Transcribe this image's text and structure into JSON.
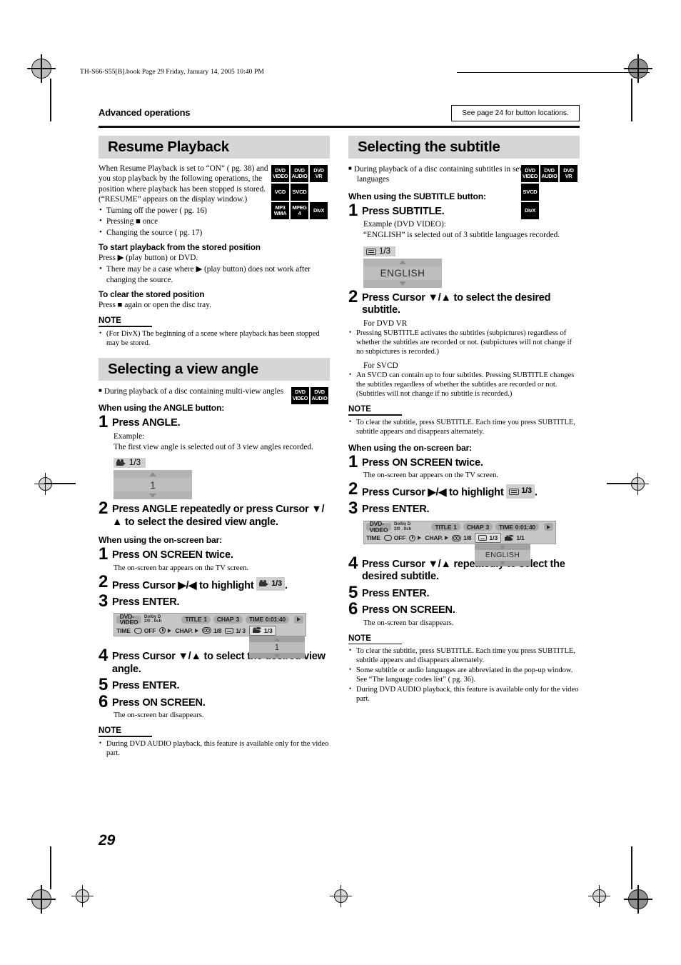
{
  "page": {
    "book_line": "TH-S66-S55[B].book  Page 29  Friday, January 14, 2005  10:40 PM",
    "section_label": "Advanced operations",
    "see_page_note": "See page 24 for button locations.",
    "page_number": "29"
  },
  "left_column": {
    "resume": {
      "title": "Resume Playback",
      "intro": "When Resume Playback is set to “ON” ( pg. 38) and you stop playback by the following operations, the position where playback has been stopped is stored. (“RESUME” appears on the display window.)",
      "bullets": [
        "Turning off the power ( pg. 16)",
        "Pressing ■ once",
        "Changing the source ( pg. 17)"
      ],
      "discs": [
        "DVD VIDEO",
        "DVD AUDIO",
        "DVD VR",
        "VCD",
        "SVCD",
        "MP3 WMA",
        "MPEG 4",
        "DivX"
      ],
      "start_head": "To start playback from the stored position",
      "start_body": "Press ▶ (play button) or DVD.",
      "start_bullets": [
        "There may be a case where ▶ (play button) does not work after changing the source."
      ],
      "clear_head": "To clear the stored position",
      "clear_body": "Press ■ again or open the disc tray.",
      "note_head": "NOTE",
      "note_bullets": [
        "(For DivX) The beginning of a scene where playback has been stopped may be stored."
      ]
    },
    "angle": {
      "title": "Selecting a view angle",
      "lead": "During playback of a disc containing multi-view angles",
      "discs": [
        "DVD VIDEO",
        "DVD AUDIO"
      ],
      "button_head": "When using the ANGLE button:",
      "steps_button": [
        {
          "num": "1",
          "text": "Press ANGLE."
        },
        {
          "num": "2",
          "text": "Press ANGLE repeatedly or press Cursor ▼/▲ to select the desired view angle."
        }
      ],
      "example_label": "Example:",
      "example_text": "The first view angle is selected out of 3 view angles recorded.",
      "popup": {
        "tag": "1/3",
        "value": "1"
      },
      "onscreen_head": "When using the on-screen bar:",
      "steps_onscreen": [
        {
          "num": "1",
          "text": "Press ON SCREEN twice.",
          "sub": "The on-screen bar appears on the TV screen."
        },
        {
          "num": "2",
          "text": "Press Cursor ▶/◀ to highlight",
          "chip": "1/3",
          "tail": "."
        },
        {
          "num": "3",
          "text": "Press ENTER."
        },
        {
          "num": "4",
          "text": "Press Cursor ▼/▲ to select the desired view angle."
        },
        {
          "num": "5",
          "text": "Press ENTER."
        },
        {
          "num": "6",
          "text": "Press ON SCREEN.",
          "sub": "The on-screen bar disappears."
        }
      ],
      "note_head": "NOTE",
      "note_bullets": [
        "During DVD AUDIO playback, this feature is available only for the video part."
      ]
    },
    "osbar": {
      "disc_type": "DVD-VIDEO",
      "dolby_line1": "Dolby D",
      "dolby_line2": "2/0 . 0ch",
      "title_label": "TITLE",
      "title_value": "1",
      "chap_label": "CHAP",
      "chap_value": "3",
      "time_label": "TIME",
      "time_value": "0:01:40",
      "row2_time": "TIME",
      "row2_repeat": "OFF",
      "row2_chapter": "CHAP.",
      "row2_audio": "1/8",
      "row2_subtitle": "1/ 3",
      "row2_angle": "1/3",
      "dropdown_value": "1"
    }
  },
  "right_column": {
    "subtitle": {
      "title": "Selecting the subtitle",
      "lead": "During playback of a disc containing subtitles in several languages",
      "discs": [
        "DVD VIDEO",
        "DVD AUDIO",
        "DVD VR",
        "SVCD",
        "DivX"
      ],
      "button_head": "When using the SUBTITLE button:",
      "steps_button": [
        {
          "num": "1",
          "text": "Press SUBTITLE."
        },
        {
          "num": "2",
          "text": "Press Cursor ▼/▲ to select the desired subtitle."
        }
      ],
      "example_label": "Example (DVD VIDEO):",
      "example_text": "“ENGLISH” is selected out of 3 subtitle languages recorded.",
      "popup": {
        "tag": "1/3",
        "value": "ENGLISH"
      },
      "dvdvr_head": "For DVD VR",
      "dvdvr_bullets": [
        "Pressing SUBTITLE activates the subtitles (subpictures) regardless of whether the subtitles are recorded or not. (subpictures will not change if no subpictures is recorded.)"
      ],
      "svcd_head": "For SVCD",
      "svcd_bullets": [
        "An SVCD can contain up to four subtitles. Pressing SUBTITLE changes the subtitles regardless of whether the subtitles are recorded or not. (Subtitles will not change if no subtitle is recorded.)"
      ],
      "note1_head": "NOTE",
      "note1_bullets": [
        "To clear the subtitle, press SUBTITLE. Each time you press SUBTITLE, subtitle appears and disappears alternately."
      ],
      "onscreen_head": "When using the on-screen bar:",
      "steps_onscreen": [
        {
          "num": "1",
          "text": "Press ON SCREEN twice.",
          "sub": "The on-screen bar appears on the TV screen."
        },
        {
          "num": "2",
          "text": "Press Cursor ▶/◀ to highlight",
          "chip": "1/3",
          "tail": "."
        },
        {
          "num": "3",
          "text": "Press ENTER."
        },
        {
          "num": "4",
          "text": "Press Cursor ▼/▲ repeatedly to select the desired subtitle."
        },
        {
          "num": "5",
          "text": "Press ENTER."
        },
        {
          "num": "6",
          "text": "Press ON SCREEN.",
          "sub": "The on-screen bar disappears."
        }
      ],
      "note2_head": "NOTE",
      "note2_bullets": [
        "To clear the subtitle, press SUBTITLE. Each time you press SUBTITLE, subtitle appears and disappears alternately.",
        "Some subtitle or audio languages are abbreviated in the pop-up window. See “The language codes list” ( pg. 36).",
        "During DVD AUDIO playback, this feature is available only for the video part."
      ]
    },
    "osbar": {
      "disc_type": "DVD-VIDEO",
      "dolby_line1": "Dolby D",
      "dolby_line2": "2/0 . 0ch",
      "title_label": "TITLE",
      "title_value": "1",
      "chap_label": "CHAP",
      "chap_value": "3",
      "time_label": "TIME",
      "time_value": "0:01:40",
      "row2_time": "TIME",
      "row2_repeat": "OFF",
      "row2_chapter": "CHAP.",
      "row2_audio": "1/8",
      "row2_subtitle": "1/3",
      "row2_angle": "1/1",
      "dropdown_value": "ENGLISH"
    }
  }
}
